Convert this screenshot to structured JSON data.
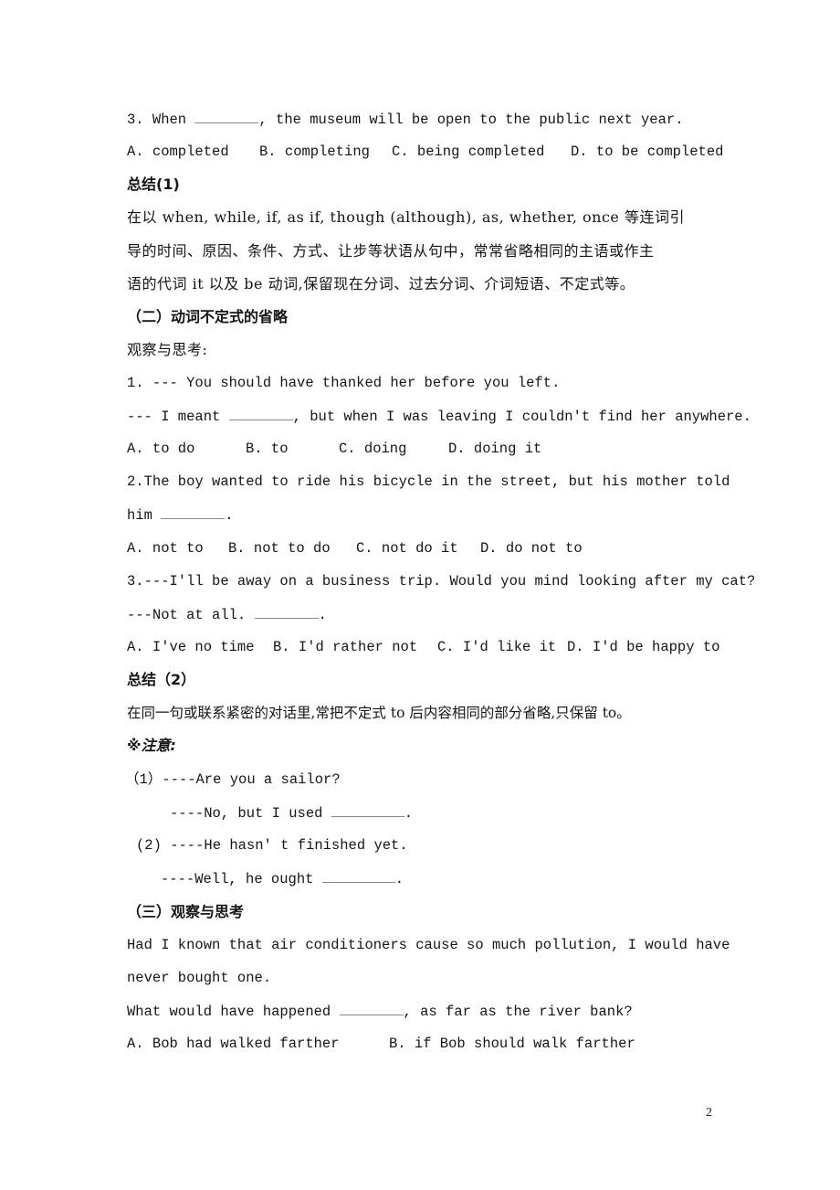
{
  "document": {
    "page_number": "2",
    "q3_ellipsis": {
      "stem_before": "3. When ",
      "stem_after": ", the museum will be open to the public next year.",
      "options": [
        "A. completed",
        "B. completing",
        "C. being completed",
        "D. to be completed"
      ]
    },
    "summary1": {
      "heading": "总结(1)",
      "lines": [
        "在以 when, while, if, as if, though (although), as, whether, once 等连词引",
        "导的时间、原因、条件、方式、让步等状语从句中，常常省略相同的主语或作主",
        "语的代词 it 以及 be 动词,保留现在分词、过去分词、介词短语、不定式等。"
      ]
    },
    "section2": {
      "heading": "（二）动词不定式的省略",
      "observe": "观察与思考:",
      "q1": {
        "line1": "1. --- You should have thanked her before you left.",
        "line2_before": "--- I meant ",
        "line2_after": ", but when I was leaving I couldn't find her anywhere.",
        "options": [
          "A. to do",
          "B. to",
          "C. doing",
          "D. doing it"
        ]
      },
      "q2": {
        "line1": "2.The boy wanted to ride his bicycle in the street, but his mother told",
        "line2_before": "him ",
        "line2_after": ".",
        "options": [
          "A. not to",
          "B. not to do",
          "C. not do it",
          "D. do not to"
        ]
      },
      "q3": {
        "line1": "3.---I'll be away on a business trip. Would you mind looking after my cat?",
        "line2_before": "---Not at all. ",
        "line2_after": ".",
        "options": [
          "A. I've no time",
          "B. I'd rather not",
          "C. I'd like it",
          "D. I'd be happy to"
        ]
      }
    },
    "summary2": {
      "heading": "总结（2）",
      "text": "在同一句或联系紧密的对话里,常把不定式 to 后内容相同的部分省略,只保留 to。"
    },
    "note": {
      "heading": "※注意:",
      "items": [
        {
          "q": "（1）----Are you a sailor?",
          "a_before": "----No, but I used ",
          "a_after": "."
        },
        {
          "q": "(2) ----He hasn' t finished yet.",
          "a_before": "----Well, he ought ",
          "a_after": "."
        }
      ]
    },
    "section3": {
      "heading": "（三）观察与思考",
      "example_line1": "Had I known that air conditioners cause so much pollution, I would have",
      "example_line2": "never bought one.",
      "question_before": "What would have happened ",
      "question_after": ", as far as the river bank?",
      "options": [
        "A. Bob had walked farther",
        "B. if Bob should walk farther"
      ]
    }
  }
}
